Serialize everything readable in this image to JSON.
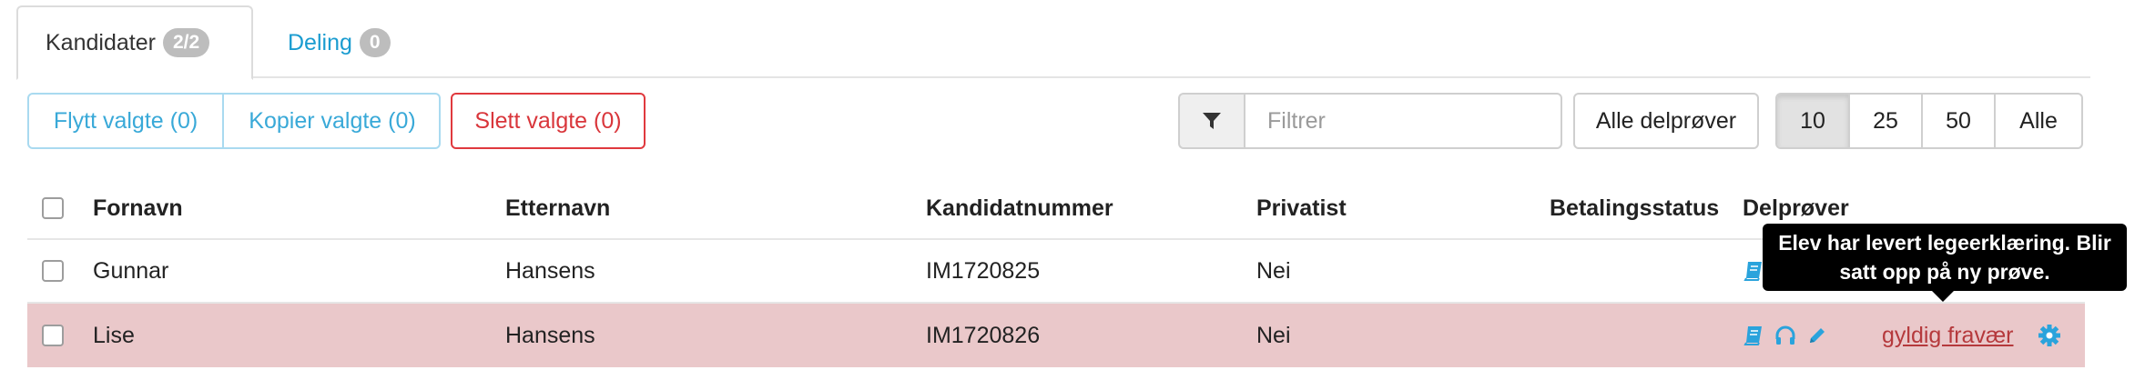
{
  "tabs": [
    {
      "label": "Kandidater",
      "badge": "2/2"
    },
    {
      "label": "Deling",
      "badge": "0"
    }
  ],
  "toolbar": {
    "move_label": "Flytt valgte (0)",
    "copy_label": "Kopier valgte (0)",
    "delete_label": "Slett valgte (0)",
    "filter_placeholder": "Filtrer",
    "all_tests_label": "Alle delprøver",
    "page_sizes": [
      "10",
      "25",
      "50",
      "Alle"
    ],
    "active_page_size": "10"
  },
  "table": {
    "headers": [
      "Fornavn",
      "Etternavn",
      "Kandidatnummer",
      "Privatist",
      "Betalingsstatus",
      "Delprøver"
    ],
    "rows": [
      {
        "fornavn": "Gunnar",
        "etternavn": "Hansens",
        "kandidatnummer": "IM1720825",
        "privatist": "Nei",
        "betalingsstatus": "",
        "status_link": ""
      },
      {
        "fornavn": "Lise",
        "etternavn": "Hansens",
        "kandidatnummer": "IM1720826",
        "privatist": "Nei",
        "betalingsstatus": "",
        "status_link": "gyldig fravær"
      }
    ]
  },
  "tooltip": {
    "text": "Elev har levert legeerklæring. Blir satt opp på ny prøve."
  },
  "colors": {
    "accent": "#1a9cd0",
    "danger": "#d9363b",
    "highlight_row": "#eac8ca",
    "icon_blue": "#2aa3dc"
  },
  "icons": [
    "filter-icon",
    "book-icon",
    "headphones-icon",
    "pencil-icon",
    "gear-icon"
  ]
}
